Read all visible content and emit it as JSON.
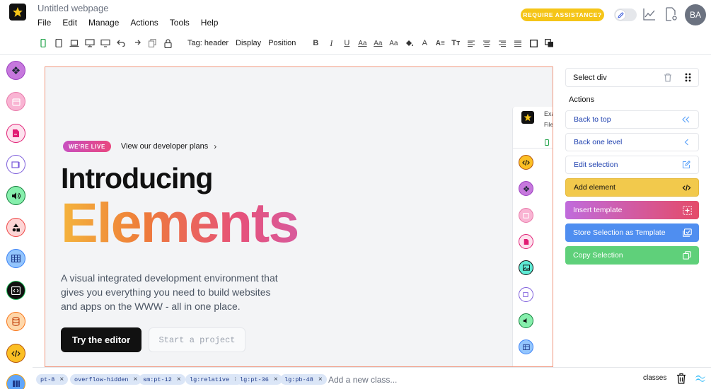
{
  "window": {
    "title": "Untitled webpage",
    "menu": [
      "File",
      "Edit",
      "Manage",
      "Actions",
      "Tools",
      "Help"
    ]
  },
  "toolbar": {
    "tag_label": "Tag: header",
    "display_label": "Display",
    "position_label": "Position"
  },
  "header_right": {
    "assist_label": "REQUIRE ASSISTANCE?",
    "avatar_initials": "BA"
  },
  "canvas": {
    "badge_label": "WE'RE LIVE",
    "dev_link": "View our developer plans",
    "hero_title": "Introducing",
    "hero_highlight": "Elements",
    "hero_description": "A visual integrated development environment that gives you everything you need to build websites and apps on the WWW - all in one place.",
    "try_button": "Try the editor",
    "start_button": "Start a project",
    "inner_preview_title": "Exa",
    "inner_preview_file": "File"
  },
  "right_panel": {
    "select_label": "Select div",
    "actions_heading": "Actions",
    "actions": [
      {
        "label": "Back to top"
      },
      {
        "label": "Back one level"
      },
      {
        "label": "Edit selection"
      },
      {
        "label": "Add element"
      },
      {
        "label": "Insert template"
      },
      {
        "label": "Store Selection as Template"
      },
      {
        "label": "Copy Selection"
      }
    ]
  },
  "classbar": {
    "chips": [
      "pt-8",
      "overflow-hidden",
      "sm:pt-12",
      "lg:relative",
      "lg:pt-36",
      "lg:pb-48"
    ],
    "placeholder": "Add a new class...",
    "classes_label": "classes"
  },
  "colors": {
    "accent_yellow": "#f5c518",
    "insert_gradient_start": "#c06bdc",
    "insert_gradient_end": "#e44b69",
    "store_blue": "#3b82f6",
    "copy_green": "#5fd07a",
    "chip_bg": "#dbe6f7",
    "frame_border": "#f09880"
  }
}
